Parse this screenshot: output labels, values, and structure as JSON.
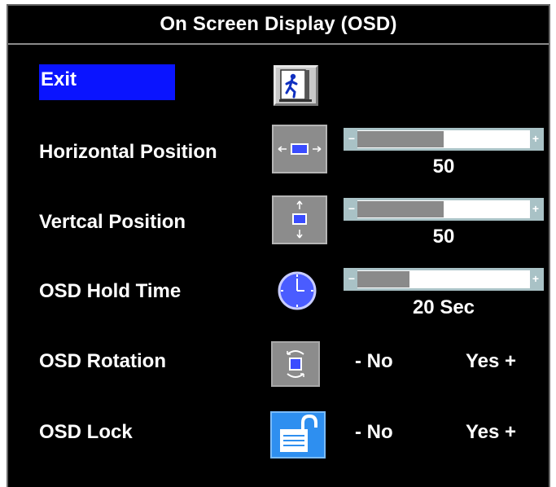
{
  "title": "On Screen Display (OSD)",
  "items": [
    {
      "label": "Exit",
      "icon": "exit-door-icon"
    },
    {
      "label": "Horizontal Position",
      "icon": "horizontal-arrows-icon",
      "value": "50",
      "level": 0.5
    },
    {
      "label": "Vertcal Position",
      "icon": "vertical-arrows-icon",
      "value": "50",
      "level": 0.5
    },
    {
      "label": "OSD Hold Time",
      "icon": "clock-icon",
      "value": "20 Sec",
      "level": 0.3
    },
    {
      "label": "OSD Rotation",
      "icon": "rotation-icon",
      "no_label": "-  No",
      "yes_label": "Yes +"
    },
    {
      "label": "OSD Lock",
      "icon": "padlock-open-icon",
      "no_label": "-  No",
      "yes_label": "Yes +"
    }
  ],
  "colors": {
    "background": "#000000",
    "selected": "#0a14ff",
    "slider_track": "#ffffff",
    "slider_fill": "#8a8a8a",
    "slider_cap": "#a9c2c6",
    "lock_icon": "#2e8ff0"
  }
}
